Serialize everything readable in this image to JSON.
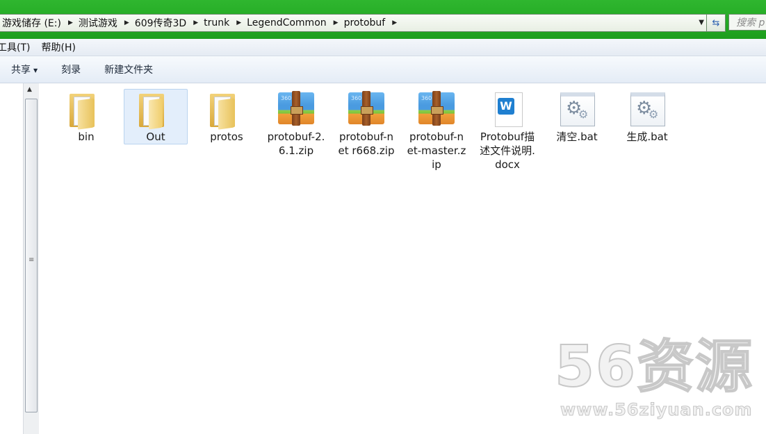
{
  "address": {
    "crumbs": [
      "游戏储存 (E:)",
      "测试游戏",
      "609传奇3D",
      "trunk",
      "LegendCommon",
      "protobuf"
    ],
    "search_placeholder": "搜索 p"
  },
  "menu": {
    "items": [
      "工具(T)",
      "帮助(H)"
    ]
  },
  "toolbar": {
    "share_label": "共享",
    "burn_label": "刻录",
    "new_folder_label": "新建文件夹"
  },
  "files": [
    {
      "name": "bin",
      "type": "folder"
    },
    {
      "name": "Out",
      "type": "folder",
      "selected": true
    },
    {
      "name": "protos",
      "type": "folder"
    },
    {
      "name": "protobuf-2.6.1.zip",
      "type": "zip"
    },
    {
      "name": "protobuf-net r668.zip",
      "type": "zip"
    },
    {
      "name": "protobuf-net-master.zip",
      "type": "zip"
    },
    {
      "name": "Protobuf描述文件说明.docx",
      "type": "docx"
    },
    {
      "name": "清空.bat",
      "type": "bat"
    },
    {
      "name": "生成.bat",
      "type": "bat"
    }
  ],
  "watermark": {
    "main": "56资源",
    "sub": "www.56ziyuan.com"
  },
  "colors": {
    "titlebar": "#23a923",
    "selection": "#e3eefb"
  }
}
